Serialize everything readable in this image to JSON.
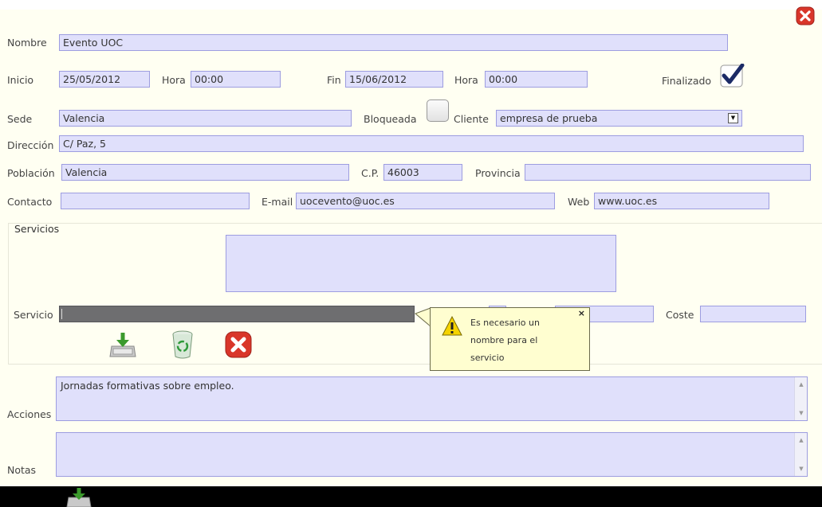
{
  "form": {
    "nombre_label": "Nombre",
    "nombre_value": "Evento  UOC",
    "inicio_label": "Inicio",
    "inicio_value": "25/05/2012",
    "hora1_label": "Hora",
    "hora1_value": "00:00",
    "fin_label": "Fin",
    "fin_value": "15/06/2012",
    "hora2_label": "Hora",
    "hora2_value": "00:00",
    "finalizado_label": "Finalizado",
    "finalizado_checked": true,
    "sede_label": "Sede",
    "sede_value": "Valencia",
    "bloqueada_label": "Bloqueada",
    "bloqueada_checked": false,
    "cliente_label": "Cliente",
    "cliente_value": "empresa de prueba",
    "direccion_label": "Dirección",
    "direccion_value": "C/ Paz, 5",
    "poblacion_label": "Población",
    "poblacion_value": "Valencia",
    "cp_label": "C.P.",
    "cp_value": "46003",
    "provincia_label": "Provincia",
    "provincia_value": "",
    "contacto_label": "Contacto",
    "contacto_value": "",
    "email_label": "E-mail",
    "email_value": "uocevento@uoc.es",
    "web_label": "Web",
    "web_value": "www.uoc.es"
  },
  "servicios": {
    "title": "Servicios",
    "servicio_label": "Servicio",
    "servicio_value": "",
    "coste_label": "Coste",
    "coste_value": "",
    "buttons": {
      "save_icon": "save-icon",
      "delete_icon": "recycle-bin-icon",
      "cancel_icon": "close-icon"
    }
  },
  "tooltip": {
    "message": "Es necesario un nombre para el servicio",
    "close": "×"
  },
  "acciones": {
    "label": "Acciones",
    "value": "Jornadas formativas sobre empleo."
  },
  "notas": {
    "label": "Notas",
    "value": ""
  },
  "colors": {
    "background": "#fffff2",
    "field": "#e0e0fb",
    "field_border": "#9d9de0",
    "close_red": "#d9362a",
    "tooltip_bg": "#fffed0"
  }
}
